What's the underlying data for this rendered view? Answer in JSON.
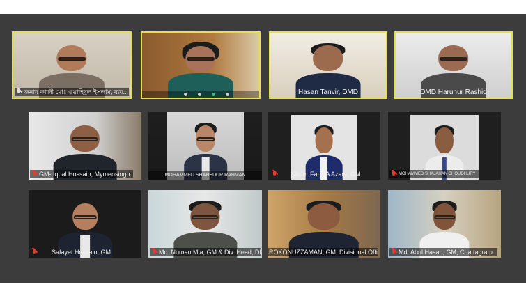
{
  "participants": [
    {
      "label": "জনাব কাজী মোঃ ওয়াহিদুল ইসলাম, ব্যব...",
      "muted": false
    },
    {
      "label": "",
      "muted": false
    },
    {
      "label": "Hasan Tanvir, DMD",
      "muted": false
    },
    {
      "label": "DMD Harunur Rashid",
      "muted": false
    },
    {
      "label": "GM- Iqbal Hossain, Mymensingh",
      "muted": true
    },
    {
      "label": "MOHAMMED SHAHEDUR RAHMAN",
      "muted": false
    },
    {
      "label": "Sikder Farid A Azam, GM",
      "muted": true
    },
    {
      "label": "MOHAMMED SHAJAHAN CHOUDHURY",
      "muted": true
    },
    {
      "label": "Safayet Hossain, GM",
      "muted": true
    },
    {
      "label": "Md. Noman Mia, GM & Div. Head, Dhak...",
      "muted": true
    },
    {
      "label": "ROKONUZZAMAN, GM, Divisional Offi...",
      "muted": false
    },
    {
      "label": "Md. Abul Hasan, GM, Chattagram.",
      "muted": true
    }
  ],
  "colors": {
    "active_border": "#e6e14a",
    "stage": "#3c3c3c",
    "muted_icon": "#e53935"
  }
}
